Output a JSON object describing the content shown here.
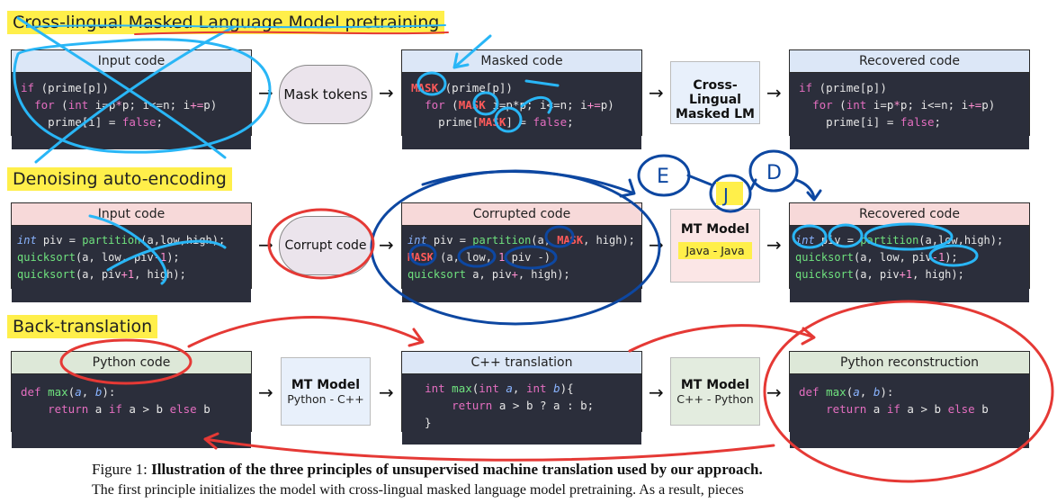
{
  "sections": {
    "s1": "Cross-lingual Masked Language Model pretraining",
    "s2": "Denoising auto-encoding",
    "s3": "Back-translation"
  },
  "row1": {
    "input_title": "Input code",
    "input_code": [
      "if (prime[p])",
      "  for (int i=p*p; i<=n; i+=p)",
      "    prime[i] = false;"
    ],
    "op": "Mask tokens",
    "masked_title": "Masked code",
    "mask_token": "MASK",
    "model_title": "Cross-Lingual Masked LM",
    "recovered_title": "Recovered code",
    "recovered_code": [
      "if (prime[p])",
      "  for (int i=p*p; i<=n; i+=p)",
      "    prime[i] = false;"
    ]
  },
  "row2": {
    "input_title": "Input code",
    "input_code": [
      "int piv = partition(a,low,high);",
      "quicksort(a, low, piv-1);",
      "quicksort(a, piv+1, high);"
    ],
    "op": "Corrupt code",
    "corrupted_title": "Corrupted code",
    "model_title": "MT Model",
    "model_sub": "Java - Java",
    "recovered_title": "Recovered code",
    "recovered_code": [
      "int piv = partition(a,low,high);",
      "quicksort(a, low, piv-1);",
      "quicksort(a, piv+1, high);"
    ]
  },
  "row3": {
    "python_title": "Python code",
    "python_code": [
      "def max(a, b):",
      "    return a if a > b else b"
    ],
    "model1_title": "MT Model",
    "model1_sub": "Python - C++",
    "cpp_title": "C++ translation",
    "cpp_code": [
      "int max(int a, int b){",
      "    return a > b ? a : b;",
      "}"
    ],
    "model2_title": "MT Model",
    "model2_sub": "C++ - Python",
    "recon_title": "Python reconstruction",
    "recon_code": [
      "def max(a, b):",
      "    return a if a > b else b"
    ]
  },
  "arrows": {
    "symbol": "→"
  },
  "annotations": {
    "e": "E",
    "j": "J",
    "d": "D"
  },
  "caption": {
    "label": "Figure 1:",
    "bold": "Illustration of the three principles of unsupervised machine translation used by our approach.",
    "line2": "The first principle initializes the model with cross-lingual masked language model pretraining. As a result, pieces"
  },
  "colors": {
    "highlight": "#ffef4a",
    "code_bg": "#2b2e3b",
    "ink_blue": "#29b6f6",
    "ink_red": "#e53935",
    "ink_navy": "#0d47a1"
  }
}
